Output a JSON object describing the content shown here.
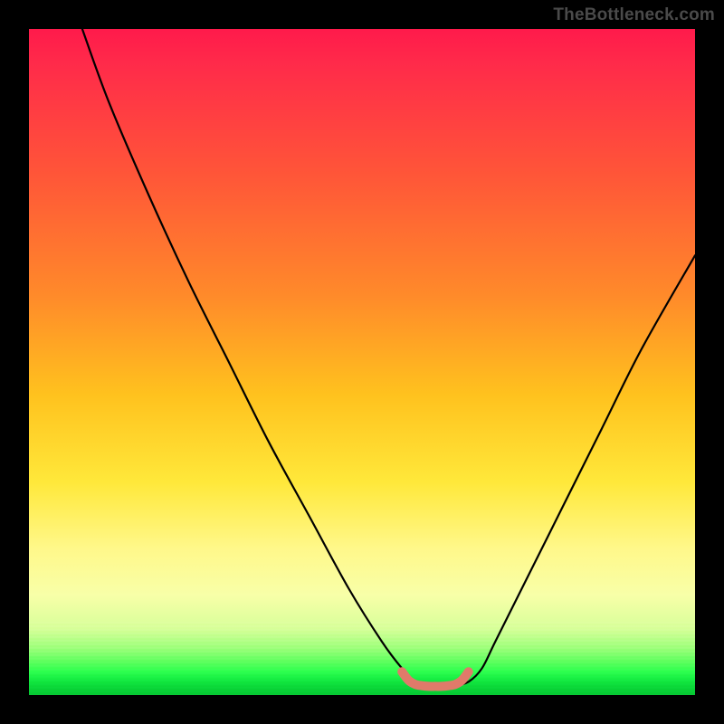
{
  "watermark": "TheBottleneck.com",
  "chart_data": {
    "type": "line",
    "title": "",
    "xlabel": "",
    "ylabel": "",
    "xlim": [
      0,
      100
    ],
    "ylim": [
      0,
      100
    ],
    "grid": false,
    "series": [
      {
        "name": "bottleneck-curve",
        "color": "#000000",
        "x": [
          8,
          12,
          18,
          24,
          30,
          36,
          42,
          48,
          53,
          56,
          58,
          60,
          62,
          64,
          66,
          68,
          70,
          74,
          80,
          86,
          92,
          100
        ],
        "y": [
          100,
          89,
          75,
          62,
          50,
          38,
          27,
          16,
          8,
          4,
          2,
          1.5,
          1.5,
          1.5,
          2,
          4,
          8,
          16,
          28,
          40,
          52,
          66
        ]
      },
      {
        "name": "minimum-marker",
        "color": "#e07a6a",
        "x": [
          56,
          57,
          58,
          59,
          60,
          61,
          62,
          63,
          64,
          65,
          66
        ],
        "y": [
          3.5,
          2.2,
          1.6,
          1.4,
          1.3,
          1.3,
          1.3,
          1.4,
          1.6,
          2.2,
          3.5
        ]
      }
    ],
    "gradient_stops": [
      {
        "pos": 0.0,
        "color": "#ff1a4b"
      },
      {
        "pos": 0.22,
        "color": "#ff5638"
      },
      {
        "pos": 0.4,
        "color": "#ff8a2a"
      },
      {
        "pos": 0.55,
        "color": "#ffc21e"
      },
      {
        "pos": 0.68,
        "color": "#ffe83a"
      },
      {
        "pos": 0.85,
        "color": "#f8ffa8"
      },
      {
        "pos": 0.95,
        "color": "#5dff5e"
      },
      {
        "pos": 1.0,
        "color": "#06c933"
      }
    ]
  }
}
